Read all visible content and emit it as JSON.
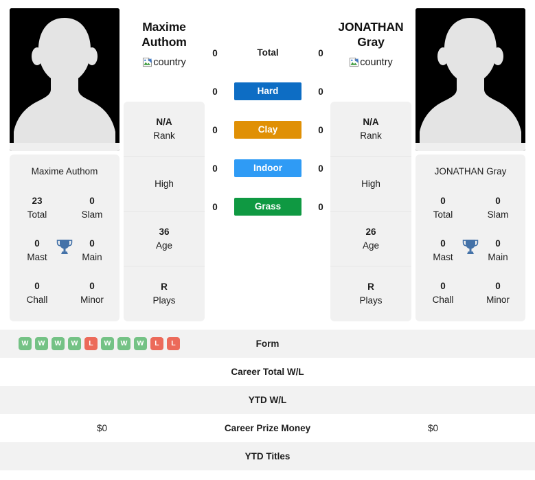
{
  "players": {
    "left": {
      "name_line1": "Maxime",
      "name_line2": "Authom",
      "full_name": "Maxime Authom",
      "flag_alt": "country",
      "photo_alt": "player-photo",
      "rank": "N/A",
      "rank_label": "Rank",
      "high": "",
      "high_label": "High",
      "age": "36",
      "age_label": "Age",
      "plays": "R",
      "plays_label": "Plays",
      "titles": {
        "total": "23",
        "total_label": "Total",
        "slam": "0",
        "slam_label": "Slam",
        "mast": "0",
        "mast_label": "Mast",
        "main": "0",
        "main_label": "Main",
        "chall": "0",
        "chall_label": "Chall",
        "minor": "0",
        "minor_label": "Minor"
      }
    },
    "right": {
      "name_line1": "JONATHAN",
      "name_line2": "Gray",
      "full_name": "JONATHAN Gray",
      "flag_alt": "country",
      "photo_alt": "player-photo",
      "rank": "N/A",
      "rank_label": "Rank",
      "high": "",
      "high_label": "High",
      "age": "26",
      "age_label": "Age",
      "plays": "R",
      "plays_label": "Plays",
      "titles": {
        "total": "0",
        "total_label": "Total",
        "slam": "0",
        "slam_label": "Slam",
        "mast": "0",
        "mast_label": "Mast",
        "main": "0",
        "main_label": "Main",
        "chall": "0",
        "chall_label": "Chall",
        "minor": "0",
        "minor_label": "Minor"
      }
    }
  },
  "surfaces": [
    {
      "label": "Total",
      "left": "0",
      "right": "0",
      "color": ""
    },
    {
      "label": "Hard",
      "left": "0",
      "right": "0",
      "color": "#0d6dc4"
    },
    {
      "label": "Clay",
      "left": "0",
      "right": "0",
      "color": "#e09005"
    },
    {
      "label": "Indoor",
      "left": "0",
      "right": "0",
      "color": "#2f9bf5"
    },
    {
      "label": "Grass",
      "left": "0",
      "right": "0",
      "color": "#0f9942"
    }
  ],
  "bottom_rows": [
    {
      "label": "Form",
      "left": "",
      "right": ""
    },
    {
      "label": "Career Total W/L",
      "left": "",
      "right": ""
    },
    {
      "label": "YTD W/L",
      "left": "",
      "right": ""
    },
    {
      "label": "Career Prize Money",
      "left": "$0",
      "right": "$0"
    },
    {
      "label": "YTD Titles",
      "left": "",
      "right": ""
    }
  ],
  "form": {
    "left": [
      "W",
      "W",
      "W",
      "W",
      "L",
      "W",
      "W",
      "W",
      "L",
      "L"
    ],
    "right": []
  },
  "colors": {
    "hard": "#0d6dc4",
    "clay": "#e09005",
    "indoor": "#2f9bf5",
    "grass": "#0f9942",
    "win": "#74c285",
    "loss": "#ec6a5a",
    "trophy": "#4472a8",
    "card_bg": "#f1f1f1"
  }
}
